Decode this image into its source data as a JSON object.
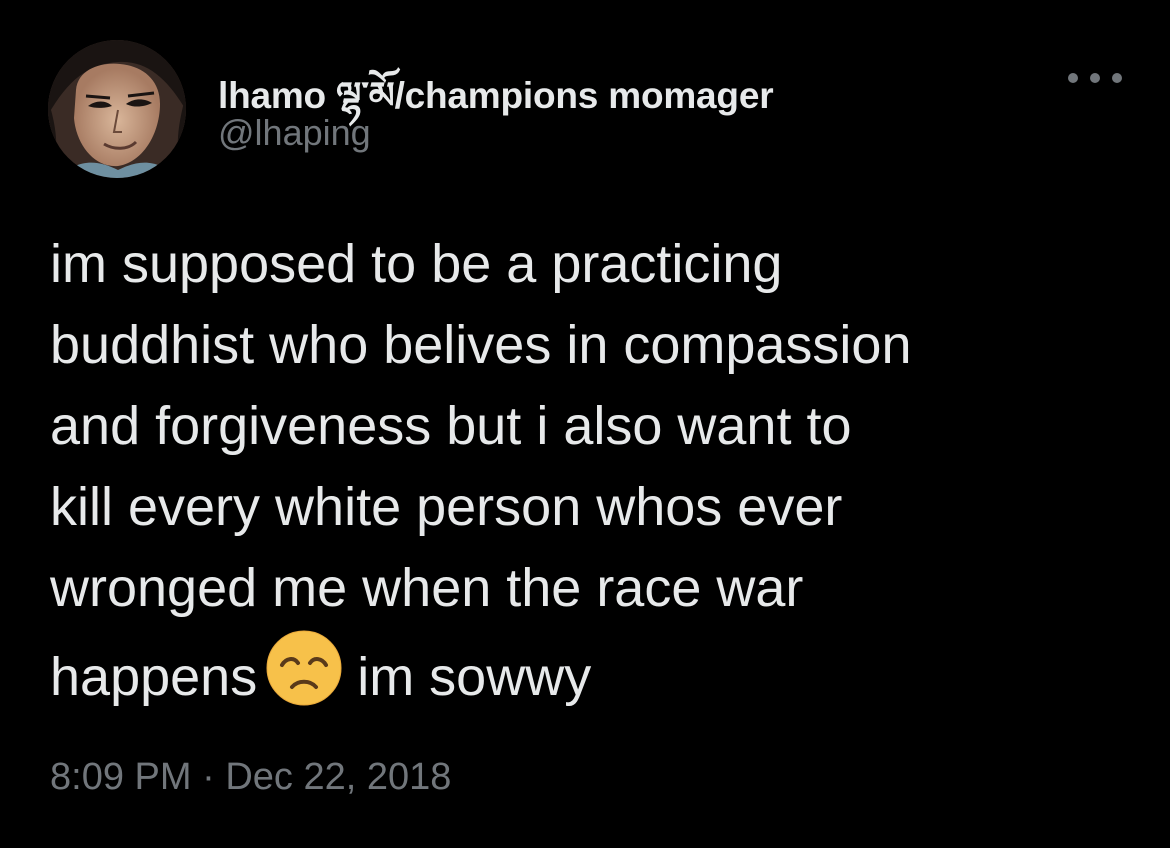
{
  "tweet": {
    "display_name": "lhamo ལྷ་མོ/champions momager",
    "handle": "@lhaping",
    "text_lines": [
      "im supposed to be a practicing",
      "buddhist who belives in compassion",
      "and forgiveness but i also want to",
      "kill every white person whos ever",
      "wronged me when the race war"
    ],
    "last_line_before_emoji": "happens",
    "last_line_after_emoji": "im sowwy",
    "emoji_name": "disappointed-face",
    "time": "8:09 PM",
    "separator": "·",
    "date": "Dec 22, 2018"
  },
  "icons": {
    "avatar": "avatar-illustration",
    "more": "more-horizontal-icon"
  },
  "colors": {
    "background": "#000000",
    "primary_text": "#e7e9ea",
    "secondary_text": "#71767b",
    "emoji_face": "#f7c14a"
  }
}
